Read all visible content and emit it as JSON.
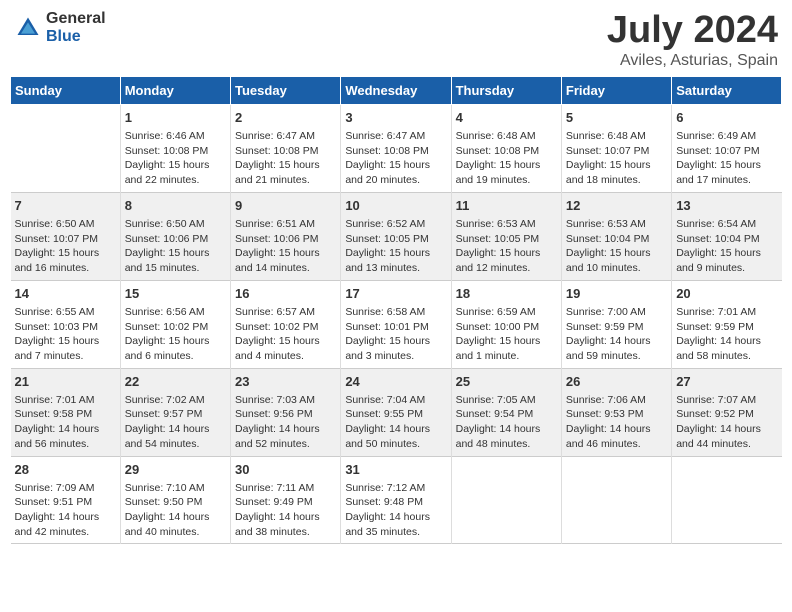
{
  "logo": {
    "general": "General",
    "blue": "Blue"
  },
  "title": "July 2024",
  "subtitle": "Aviles, Asturias, Spain",
  "days_of_week": [
    "Sunday",
    "Monday",
    "Tuesday",
    "Wednesday",
    "Thursday",
    "Friday",
    "Saturday"
  ],
  "weeks": [
    {
      "id": "week1",
      "cells": [
        {
          "day": "",
          "content": ""
        },
        {
          "day": "1",
          "content": "Sunrise: 6:46 AM\nSunset: 10:08 PM\nDaylight: 15 hours\nand 22 minutes."
        },
        {
          "day": "2",
          "content": "Sunrise: 6:47 AM\nSunset: 10:08 PM\nDaylight: 15 hours\nand 21 minutes."
        },
        {
          "day": "3",
          "content": "Sunrise: 6:47 AM\nSunset: 10:08 PM\nDaylight: 15 hours\nand 20 minutes."
        },
        {
          "day": "4",
          "content": "Sunrise: 6:48 AM\nSunset: 10:08 PM\nDaylight: 15 hours\nand 19 minutes."
        },
        {
          "day": "5",
          "content": "Sunrise: 6:48 AM\nSunset: 10:07 PM\nDaylight: 15 hours\nand 18 minutes."
        },
        {
          "day": "6",
          "content": "Sunrise: 6:49 AM\nSunset: 10:07 PM\nDaylight: 15 hours\nand 17 minutes."
        }
      ]
    },
    {
      "id": "week2",
      "cells": [
        {
          "day": "7",
          "content": "Sunrise: 6:50 AM\nSunset: 10:07 PM\nDaylight: 15 hours\nand 16 minutes."
        },
        {
          "day": "8",
          "content": "Sunrise: 6:50 AM\nSunset: 10:06 PM\nDaylight: 15 hours\nand 15 minutes."
        },
        {
          "day": "9",
          "content": "Sunrise: 6:51 AM\nSunset: 10:06 PM\nDaylight: 15 hours\nand 14 minutes."
        },
        {
          "day": "10",
          "content": "Sunrise: 6:52 AM\nSunset: 10:05 PM\nDaylight: 15 hours\nand 13 minutes."
        },
        {
          "day": "11",
          "content": "Sunrise: 6:53 AM\nSunset: 10:05 PM\nDaylight: 15 hours\nand 12 minutes."
        },
        {
          "day": "12",
          "content": "Sunrise: 6:53 AM\nSunset: 10:04 PM\nDaylight: 15 hours\nand 10 minutes."
        },
        {
          "day": "13",
          "content": "Sunrise: 6:54 AM\nSunset: 10:04 PM\nDaylight: 15 hours\nand 9 minutes."
        }
      ]
    },
    {
      "id": "week3",
      "cells": [
        {
          "day": "14",
          "content": "Sunrise: 6:55 AM\nSunset: 10:03 PM\nDaylight: 15 hours\nand 7 minutes."
        },
        {
          "day": "15",
          "content": "Sunrise: 6:56 AM\nSunset: 10:02 PM\nDaylight: 15 hours\nand 6 minutes."
        },
        {
          "day": "16",
          "content": "Sunrise: 6:57 AM\nSunset: 10:02 PM\nDaylight: 15 hours\nand 4 minutes."
        },
        {
          "day": "17",
          "content": "Sunrise: 6:58 AM\nSunset: 10:01 PM\nDaylight: 15 hours\nand 3 minutes."
        },
        {
          "day": "18",
          "content": "Sunrise: 6:59 AM\nSunset: 10:00 PM\nDaylight: 15 hours\nand 1 minute."
        },
        {
          "day": "19",
          "content": "Sunrise: 7:00 AM\nSunset: 9:59 PM\nDaylight: 14 hours\nand 59 minutes."
        },
        {
          "day": "20",
          "content": "Sunrise: 7:01 AM\nSunset: 9:59 PM\nDaylight: 14 hours\nand 58 minutes."
        }
      ]
    },
    {
      "id": "week4",
      "cells": [
        {
          "day": "21",
          "content": "Sunrise: 7:01 AM\nSunset: 9:58 PM\nDaylight: 14 hours\nand 56 minutes."
        },
        {
          "day": "22",
          "content": "Sunrise: 7:02 AM\nSunset: 9:57 PM\nDaylight: 14 hours\nand 54 minutes."
        },
        {
          "day": "23",
          "content": "Sunrise: 7:03 AM\nSunset: 9:56 PM\nDaylight: 14 hours\nand 52 minutes."
        },
        {
          "day": "24",
          "content": "Sunrise: 7:04 AM\nSunset: 9:55 PM\nDaylight: 14 hours\nand 50 minutes."
        },
        {
          "day": "25",
          "content": "Sunrise: 7:05 AM\nSunset: 9:54 PM\nDaylight: 14 hours\nand 48 minutes."
        },
        {
          "day": "26",
          "content": "Sunrise: 7:06 AM\nSunset: 9:53 PM\nDaylight: 14 hours\nand 46 minutes."
        },
        {
          "day": "27",
          "content": "Sunrise: 7:07 AM\nSunset: 9:52 PM\nDaylight: 14 hours\nand 44 minutes."
        }
      ]
    },
    {
      "id": "week5",
      "cells": [
        {
          "day": "28",
          "content": "Sunrise: 7:09 AM\nSunset: 9:51 PM\nDaylight: 14 hours\nand 42 minutes."
        },
        {
          "day": "29",
          "content": "Sunrise: 7:10 AM\nSunset: 9:50 PM\nDaylight: 14 hours\nand 40 minutes."
        },
        {
          "day": "30",
          "content": "Sunrise: 7:11 AM\nSunset: 9:49 PM\nDaylight: 14 hours\nand 38 minutes."
        },
        {
          "day": "31",
          "content": "Sunrise: 7:12 AM\nSunset: 9:48 PM\nDaylight: 14 hours\nand 35 minutes."
        },
        {
          "day": "",
          "content": ""
        },
        {
          "day": "",
          "content": ""
        },
        {
          "day": "",
          "content": ""
        }
      ]
    }
  ]
}
